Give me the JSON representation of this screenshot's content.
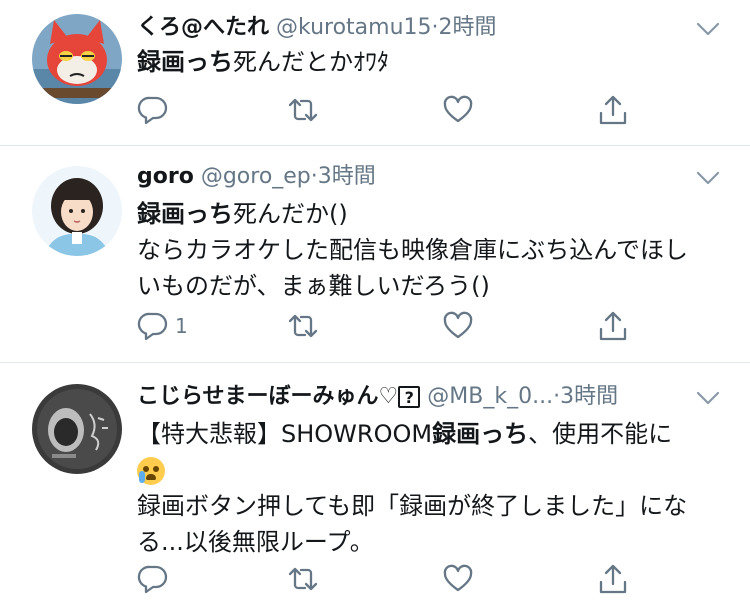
{
  "tweets": [
    {
      "name": "くろ@へたれ",
      "handle": "@kurotamu15",
      "sep": "·",
      "time": "2時間",
      "body_bold": "録画っち",
      "body_rest": "死んだとかｵﾜﾀ",
      "reply_count": ""
    },
    {
      "name": "goro",
      "handle": "@goro_ep",
      "sep": "·",
      "time": "3時間",
      "body_bold": "録画っち",
      "body_rest": "死んだか()",
      "body_line2": "ならカラオケした配信も映像倉庫にぶち込んでほし",
      "body_line3": "いものだが、まぁ難しいだろう()",
      "reply_count": "1"
    },
    {
      "name": "こじらせまーぼーみゅん♡",
      "name_box": "?",
      "handle": "@MB_k_0...",
      "sep": "·",
      "time": "3時間",
      "body_pre": "【特大悲報】SHOWROOM",
      "body_bold": "録画っち",
      "body_post": "、使用不能に",
      "body_line3": "録画ボタン押しても即「録画が終了しました」にな",
      "body_line4": "る...以後無限ループ。",
      "reply_count": ""
    }
  ],
  "icons": [
    "reply-icon",
    "retweet-icon",
    "like-icon",
    "share-icon",
    "chevron-down-icon",
    "loudly-crying-face-emoji"
  ],
  "colors": {
    "text": "#14171a",
    "muted": "#657786",
    "divider": "#e1e8ed"
  }
}
